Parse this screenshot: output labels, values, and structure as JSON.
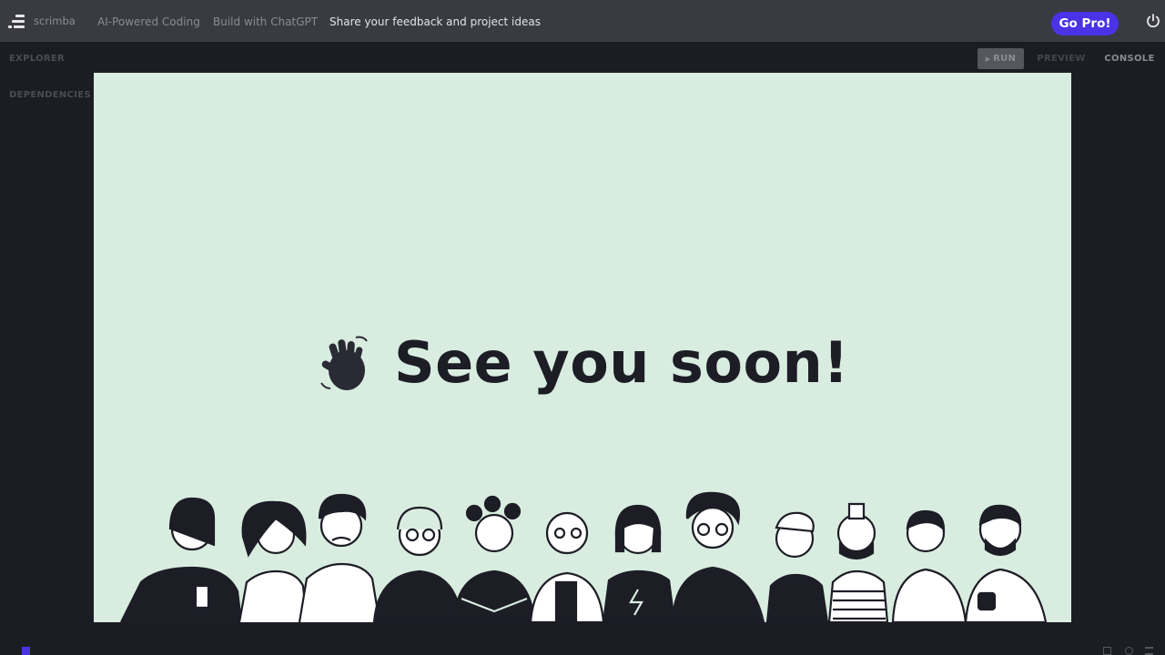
{
  "header": {
    "brand": "scrimba",
    "nav": [
      "AI-Powered Coding",
      "Build with ChatGPT",
      "Share your feedback and project ideas"
    ],
    "cta_label": "Go Pro!",
    "icons": {
      "logo": "scrimba-logo-icon",
      "power": "power-icon"
    }
  },
  "sidebar": {
    "items": [
      "EXPLORER",
      "DEPENDENCIES"
    ]
  },
  "tabs": {
    "run": "RUN",
    "preview": "PREVIEW",
    "console": "CONSOLE"
  },
  "preview": {
    "emoji": "waving-hand-icon",
    "headline": "See you soon!",
    "illustration": "people-crowd-illustration",
    "background_color": "#d9ece0",
    "text_color": "#1d1d26"
  },
  "colors": {
    "topbar": "#3a3b42",
    "app_background": "#1c1d24",
    "accent": "#4a33e6"
  }
}
